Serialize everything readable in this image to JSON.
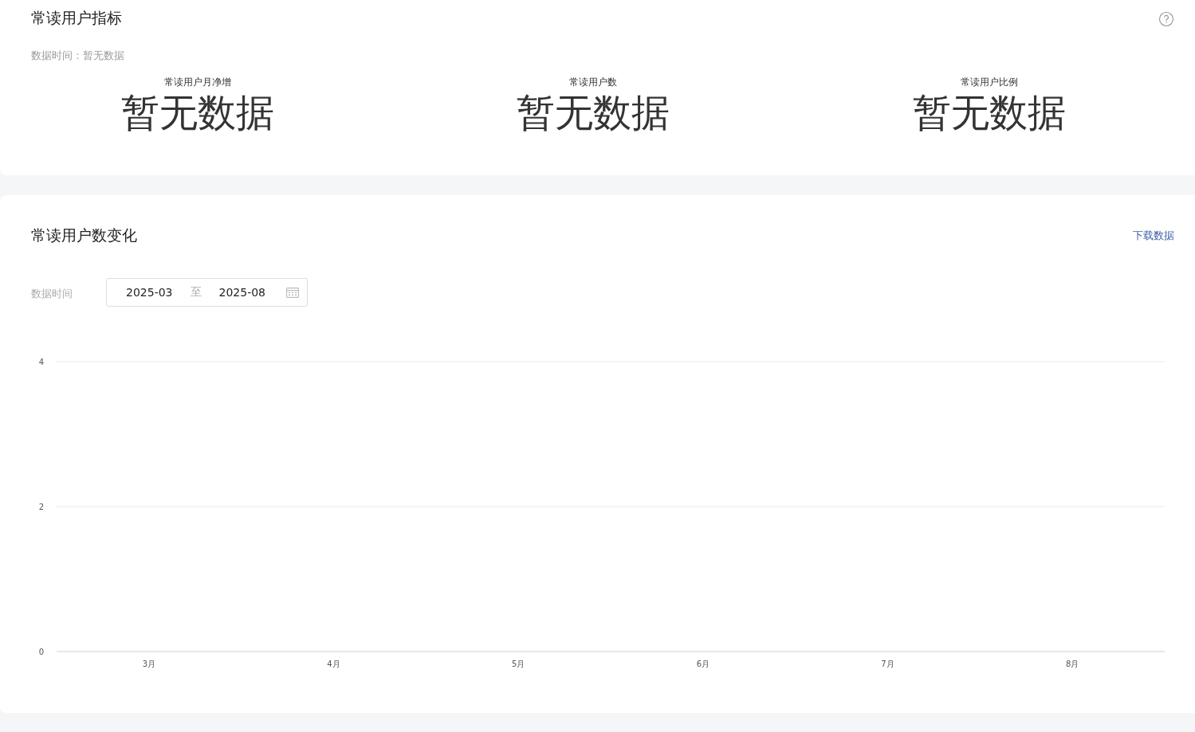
{
  "metrics_card": {
    "title": "常读用户指标",
    "data_time": "数据时间：暂无数据",
    "metrics": [
      {
        "label": "常读用户月净增",
        "value": "暂无数据"
      },
      {
        "label": "常读用户数",
        "value": "暂无数据"
      },
      {
        "label": "常读用户比例",
        "value": "暂无数据"
      }
    ]
  },
  "trend_card": {
    "title": "常读用户数变化",
    "download_link": "下载数据",
    "filter_label": "数据时间",
    "date_range": {
      "start": "2025-03",
      "separator": "至",
      "end": "2025-08"
    },
    "chart_data": {
      "type": "line",
      "categories": [
        "3月",
        "4月",
        "5月",
        "6月",
        "7月",
        "8月"
      ],
      "ylim": [
        0,
        4
      ],
      "yticks": [
        0,
        2,
        4
      ]
    }
  }
}
